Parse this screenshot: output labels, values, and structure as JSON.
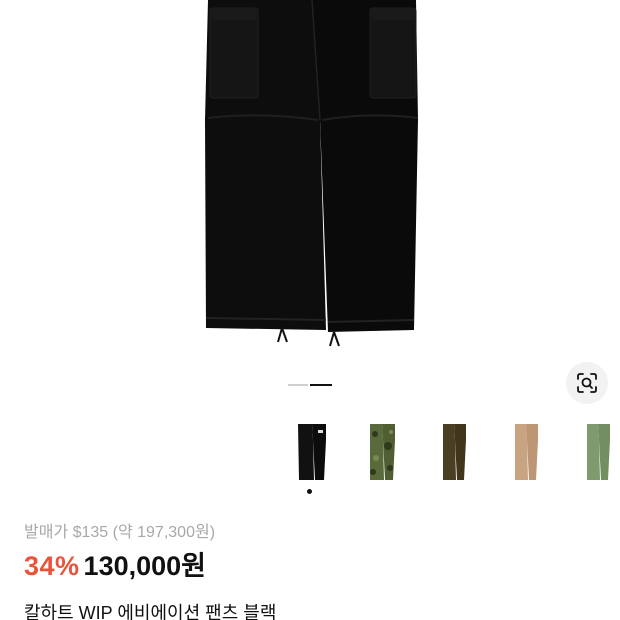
{
  "product": {
    "original_price_label": "발매가 $135 (약 197,300원)",
    "discount": "34%",
    "sale_price": "130,000원",
    "title": "칼하트 WIP 에비에이션 팬츠 블랙"
  },
  "gallery": {
    "active_slide": 2,
    "slide_count": 2,
    "lens_icon": "image-search-icon"
  },
  "color_options": [
    {
      "name": "black",
      "color": "#111111",
      "selected": true
    },
    {
      "name": "camo",
      "color": "#5a6a3a",
      "selected": false
    },
    {
      "name": "olive",
      "color": "#4a3f22",
      "selected": false
    },
    {
      "name": "tan",
      "color": "#c9a482",
      "selected": false
    },
    {
      "name": "green",
      "color": "#7f9a6c",
      "selected": false
    }
  ],
  "colors": {
    "discount": "#e8533a",
    "muted": "#a8a8a8"
  }
}
